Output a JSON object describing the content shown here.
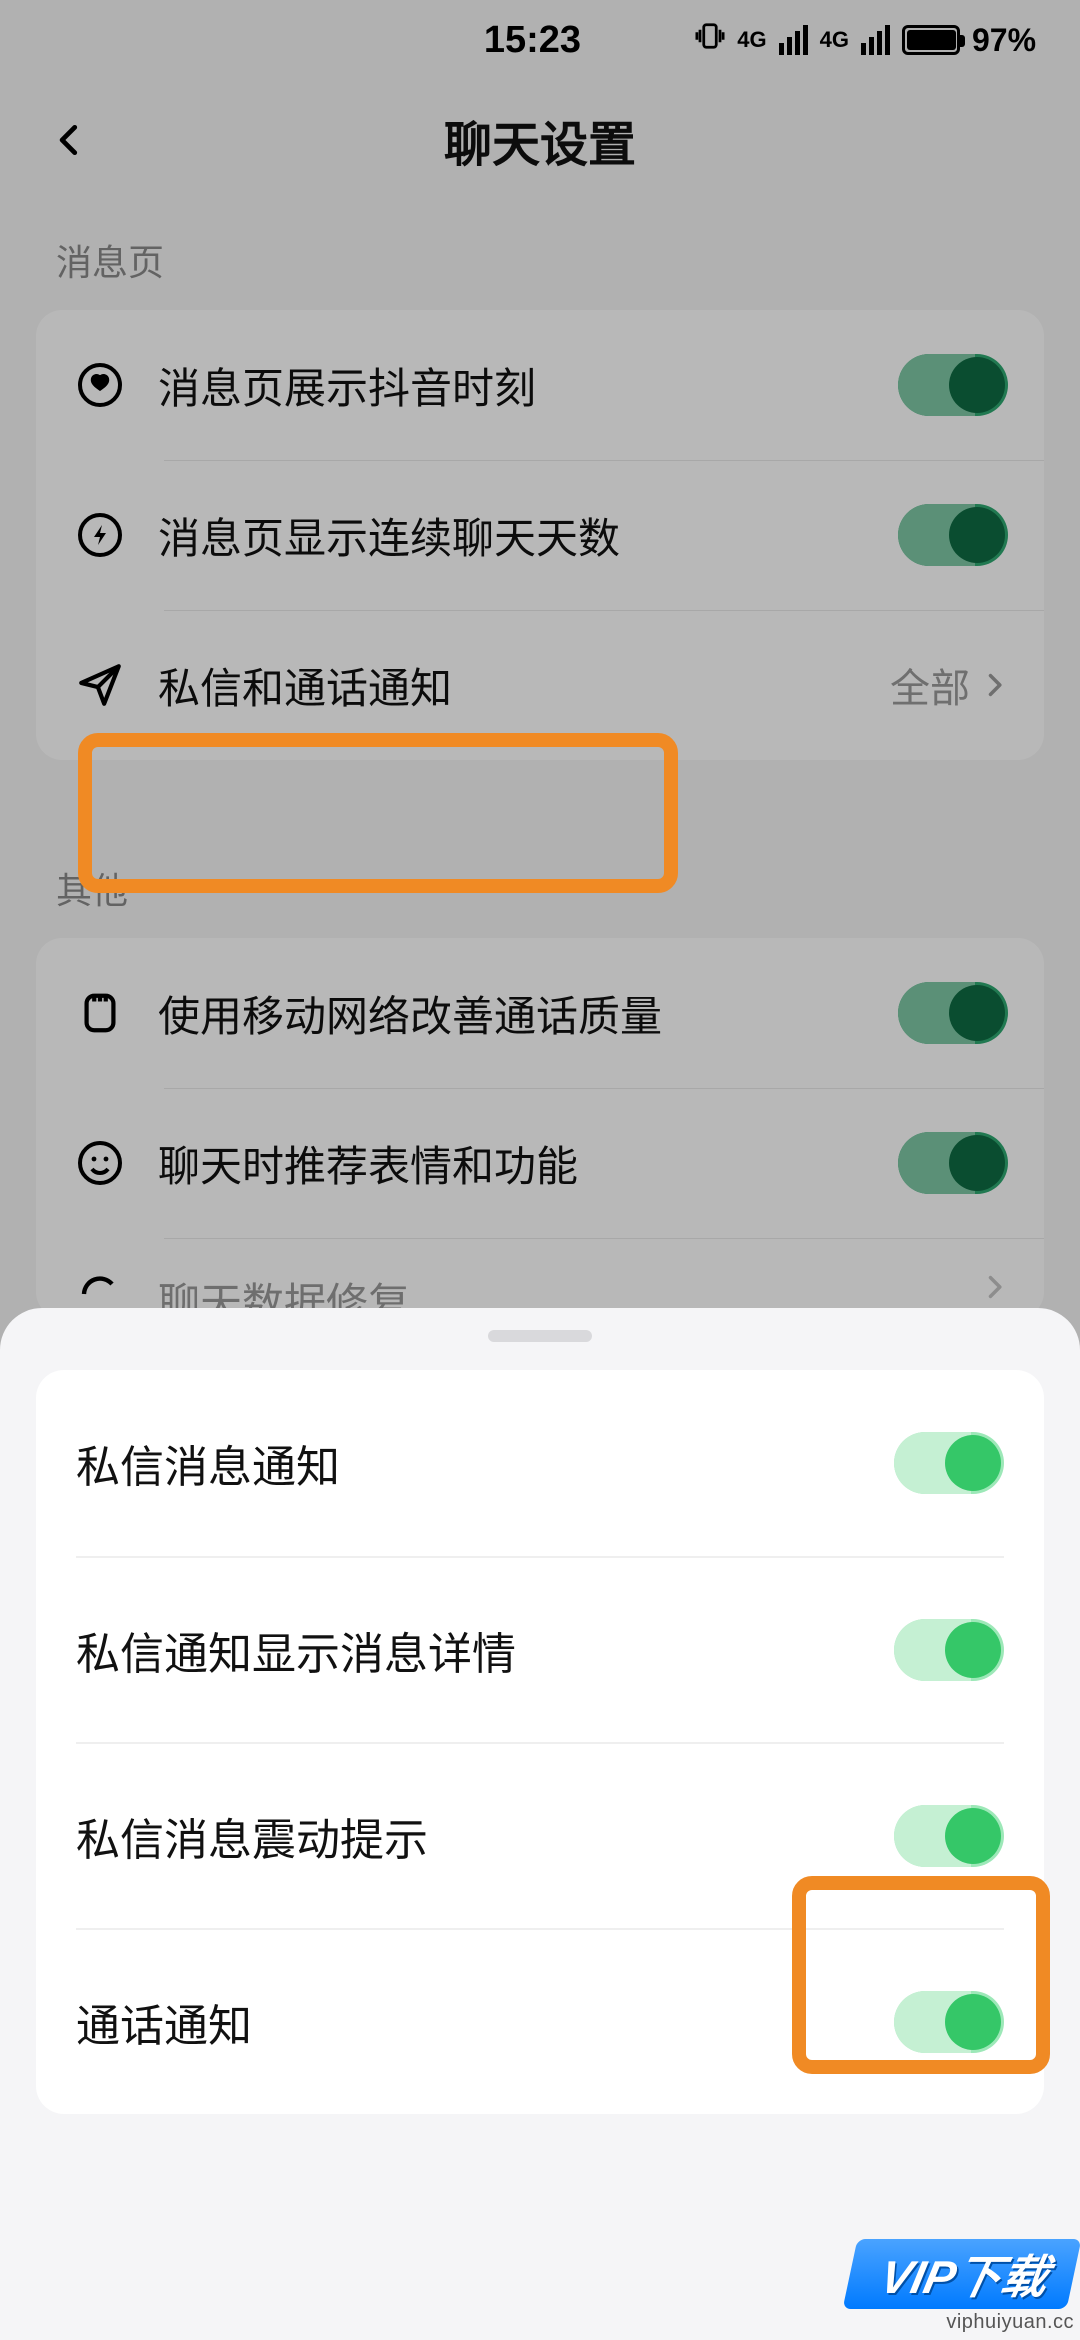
{
  "status": {
    "time": "15:23",
    "net1": "4G",
    "net2": "4G",
    "battery_pct": "97%"
  },
  "header": {
    "title": "聊天设置"
  },
  "sections": {
    "msg_page": {
      "label": "消息页",
      "items": [
        {
          "label": "消息页展示抖音时刻",
          "toggle_on": true
        },
        {
          "label": "消息页显示连续聊天天数",
          "toggle_on": true
        },
        {
          "label": "私信和通话通知",
          "value": "全部"
        }
      ]
    },
    "other": {
      "label": "其他",
      "items": [
        {
          "label": "使用移动网络改善通话质量",
          "toggle_on": true
        },
        {
          "label": "聊天时推荐表情和功能",
          "toggle_on": true
        },
        {
          "label": "聊天数据修复"
        }
      ]
    }
  },
  "sheet": {
    "items": [
      {
        "label": "私信消息通知",
        "toggle_on": true
      },
      {
        "label": "私信通知显示消息详情",
        "toggle_on": true
      },
      {
        "label": "私信消息震动提示",
        "toggle_on": true
      },
      {
        "label": "通话通知",
        "toggle_on": true
      }
    ]
  },
  "watermark": {
    "brand": "VIP下载",
    "url": "viphuiyuan.cc"
  }
}
